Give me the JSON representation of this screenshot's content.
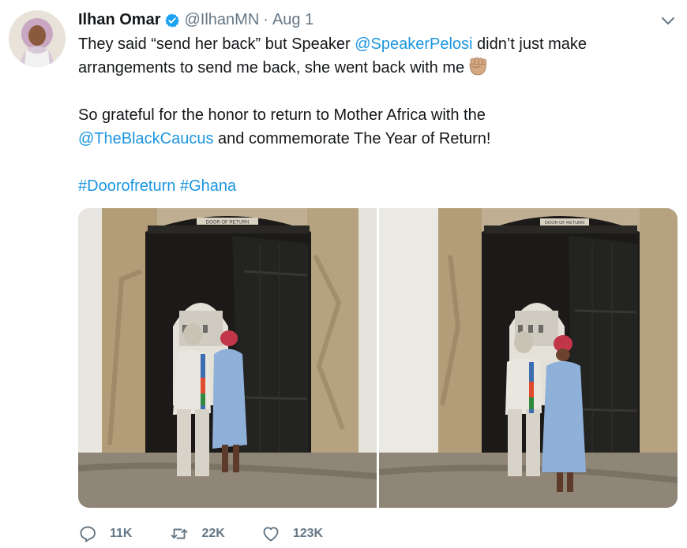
{
  "tweet": {
    "author_name": "Ilhan Omar",
    "handle": "@IlhanMN",
    "separator": "·",
    "timestamp": "Aug 1",
    "line1_pre": "They said “send her back” but Speaker ",
    "line1_mention": "@SpeakerPelosi",
    "line1_post": " didn’t just make",
    "line2": "arrangements to send me back, she went back with me",
    "line3": "So grateful for the honor to return to Mother Africa with the",
    "line4_mention": "@TheBlackCaucus",
    "line4_post": " and  commemorate The Year of Return!",
    "hashtag1": "#Doorofreturn",
    "hashtag2": "#Ghana",
    "door_sign": "DOOR OF RETURN"
  },
  "actions": {
    "replies": "11K",
    "retweets": "22K",
    "likes": "123K"
  },
  "icons": [
    "avatar",
    "verified-badge-icon",
    "chevron-down-icon",
    "raised-fist-emoji-icon",
    "reply-icon",
    "retweet-icon",
    "like-icon"
  ],
  "colors": {
    "text": "#14171a",
    "secondary": "#657786",
    "link": "#1b95e0",
    "verified": "#1da1f2"
  }
}
